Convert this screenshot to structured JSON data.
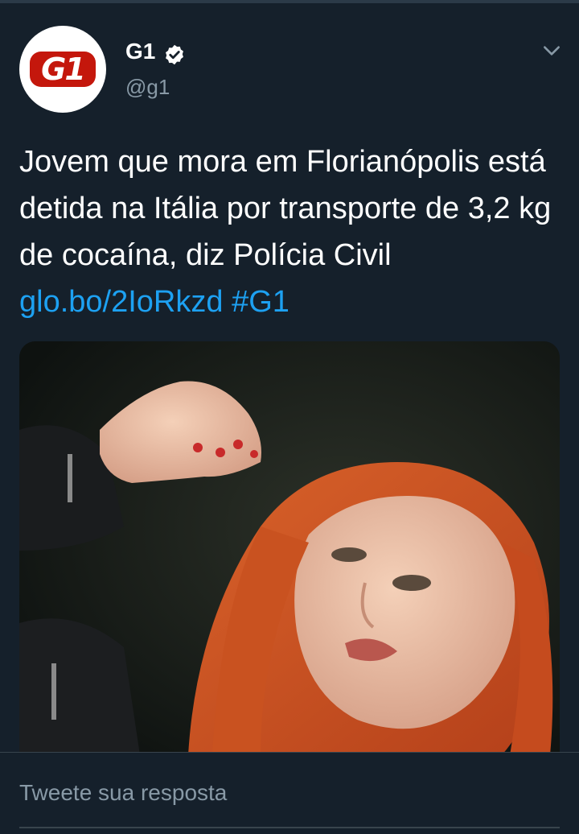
{
  "account": {
    "name": "G1",
    "handle": "@g1",
    "logo_text": "G1",
    "verified_icon": "verified-badge-icon",
    "brand_color": "#c4170c"
  },
  "tweet": {
    "text": "Jovem que mora em Florianópolis está detida na Itália por transporte de 3,2 kg de cocaína, diz Polícia Civil",
    "link": "glo.bo/2IoRkzd",
    "hashtag": "#G1",
    "link_color": "#1da1f2"
  },
  "reply": {
    "placeholder": "Tweete sua resposta"
  },
  "theme": {
    "background": "#15202b",
    "secondary_text": "#8899a6"
  }
}
